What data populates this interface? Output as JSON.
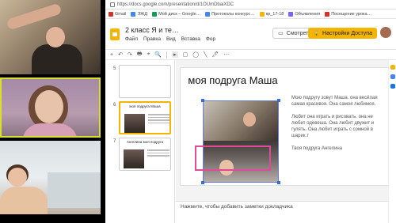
{
  "browser": {
    "url": "https://docs.google.com/presentation/d/1OUmDbaiXDC",
    "bookmarks": [
      {
        "label": "Gmail",
        "color": "#d93025"
      },
      {
        "label": "ЭЖД",
        "color": "#4285f4"
      },
      {
        "label": "Мой диск – Google…",
        "color": "#0f9d58"
      },
      {
        "label": "Протоколы конкурс…",
        "color": "#4285f4"
      },
      {
        "label": "кр_17-18",
        "color": "#f4b400"
      },
      {
        "label": "Объявления",
        "color": "#7b61ff"
      },
      {
        "label": "Посещение урока…",
        "color": "#d93025"
      }
    ]
  },
  "doc": {
    "title": "2 класс Я и те…",
    "menu": [
      "Файл",
      "Правка",
      "Вид",
      "Вставка",
      "Фор"
    ],
    "show_label": "Смотреть",
    "share_label": "Настройки Доступа"
  },
  "toolbar": {
    "items": [
      "+",
      "↶",
      "↷",
      "🖶",
      "⌖",
      "🔍",
      "▸",
      "▢",
      "◯",
      "╲",
      "🖊",
      "⋯"
    ]
  },
  "filmstrip": {
    "slides": [
      {
        "number": "5",
        "title": ""
      },
      {
        "number": "6",
        "title": "моя подруга Маша"
      },
      {
        "number": "7",
        "title": "Ангелина моя подруга"
      }
    ]
  },
  "slide": {
    "title": "моя подруга Маша",
    "paragraphs": [
      "Мою подругу зовут Маша. она весёлая самая красивоя. Она самоя любимоя.",
      "Любит она играть и рисовать. она не любит одевеша. Она любит двужит и гулять. Она любит играть с сомной в шарик.т",
      "Твоя подруга Ангелина"
    ]
  },
  "notes": {
    "placeholder": "Нажмите, чтобы добавить заметки докладчика"
  },
  "colors": {
    "accent": "#f4b400",
    "highlight": "#e14a9b",
    "selection": "#2f6fe4"
  }
}
